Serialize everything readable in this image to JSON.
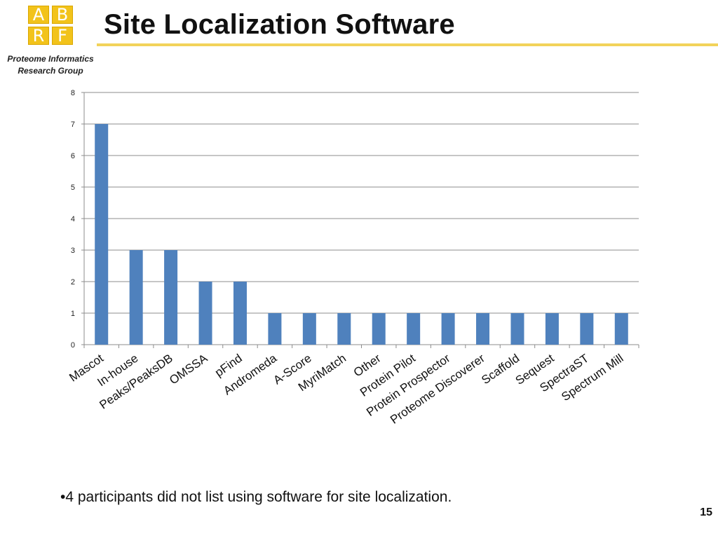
{
  "logo": {
    "letters": [
      "A",
      "B",
      "R",
      "F"
    ],
    "color": "#f2c31b"
  },
  "header": {
    "org_line1": "Proteome Informatics",
    "org_line2": "Research Group",
    "title": "Site Localization Software",
    "accent_color": "#f2d35a"
  },
  "chart_data": {
    "type": "bar",
    "title": "",
    "xlabel": "",
    "ylabel": "",
    "categories": [
      "Mascot",
      "In-house",
      "Peaks/PeaksDB",
      "OMSSA",
      "pFind",
      "Andromeda",
      "A-Score",
      "MyriMatch",
      "Other",
      "Protein Pilot",
      "Protein Prospector",
      "Proteome Discoverer",
      "Scaffold",
      "Sequest",
      "SpectraST",
      "Spectrum Mill"
    ],
    "values": [
      7,
      3,
      3,
      2,
      2,
      1,
      1,
      1,
      1,
      1,
      1,
      1,
      1,
      1,
      1,
      1
    ],
    "ylim": [
      0,
      8
    ],
    "yticks": [
      0,
      1,
      2,
      3,
      4,
      5,
      6,
      7,
      8
    ],
    "grid": true,
    "bar_color": "#4f81bd"
  },
  "footer": {
    "bullet_text": "•4 participants did not list using software for site localization.",
    "page_number": "15"
  }
}
